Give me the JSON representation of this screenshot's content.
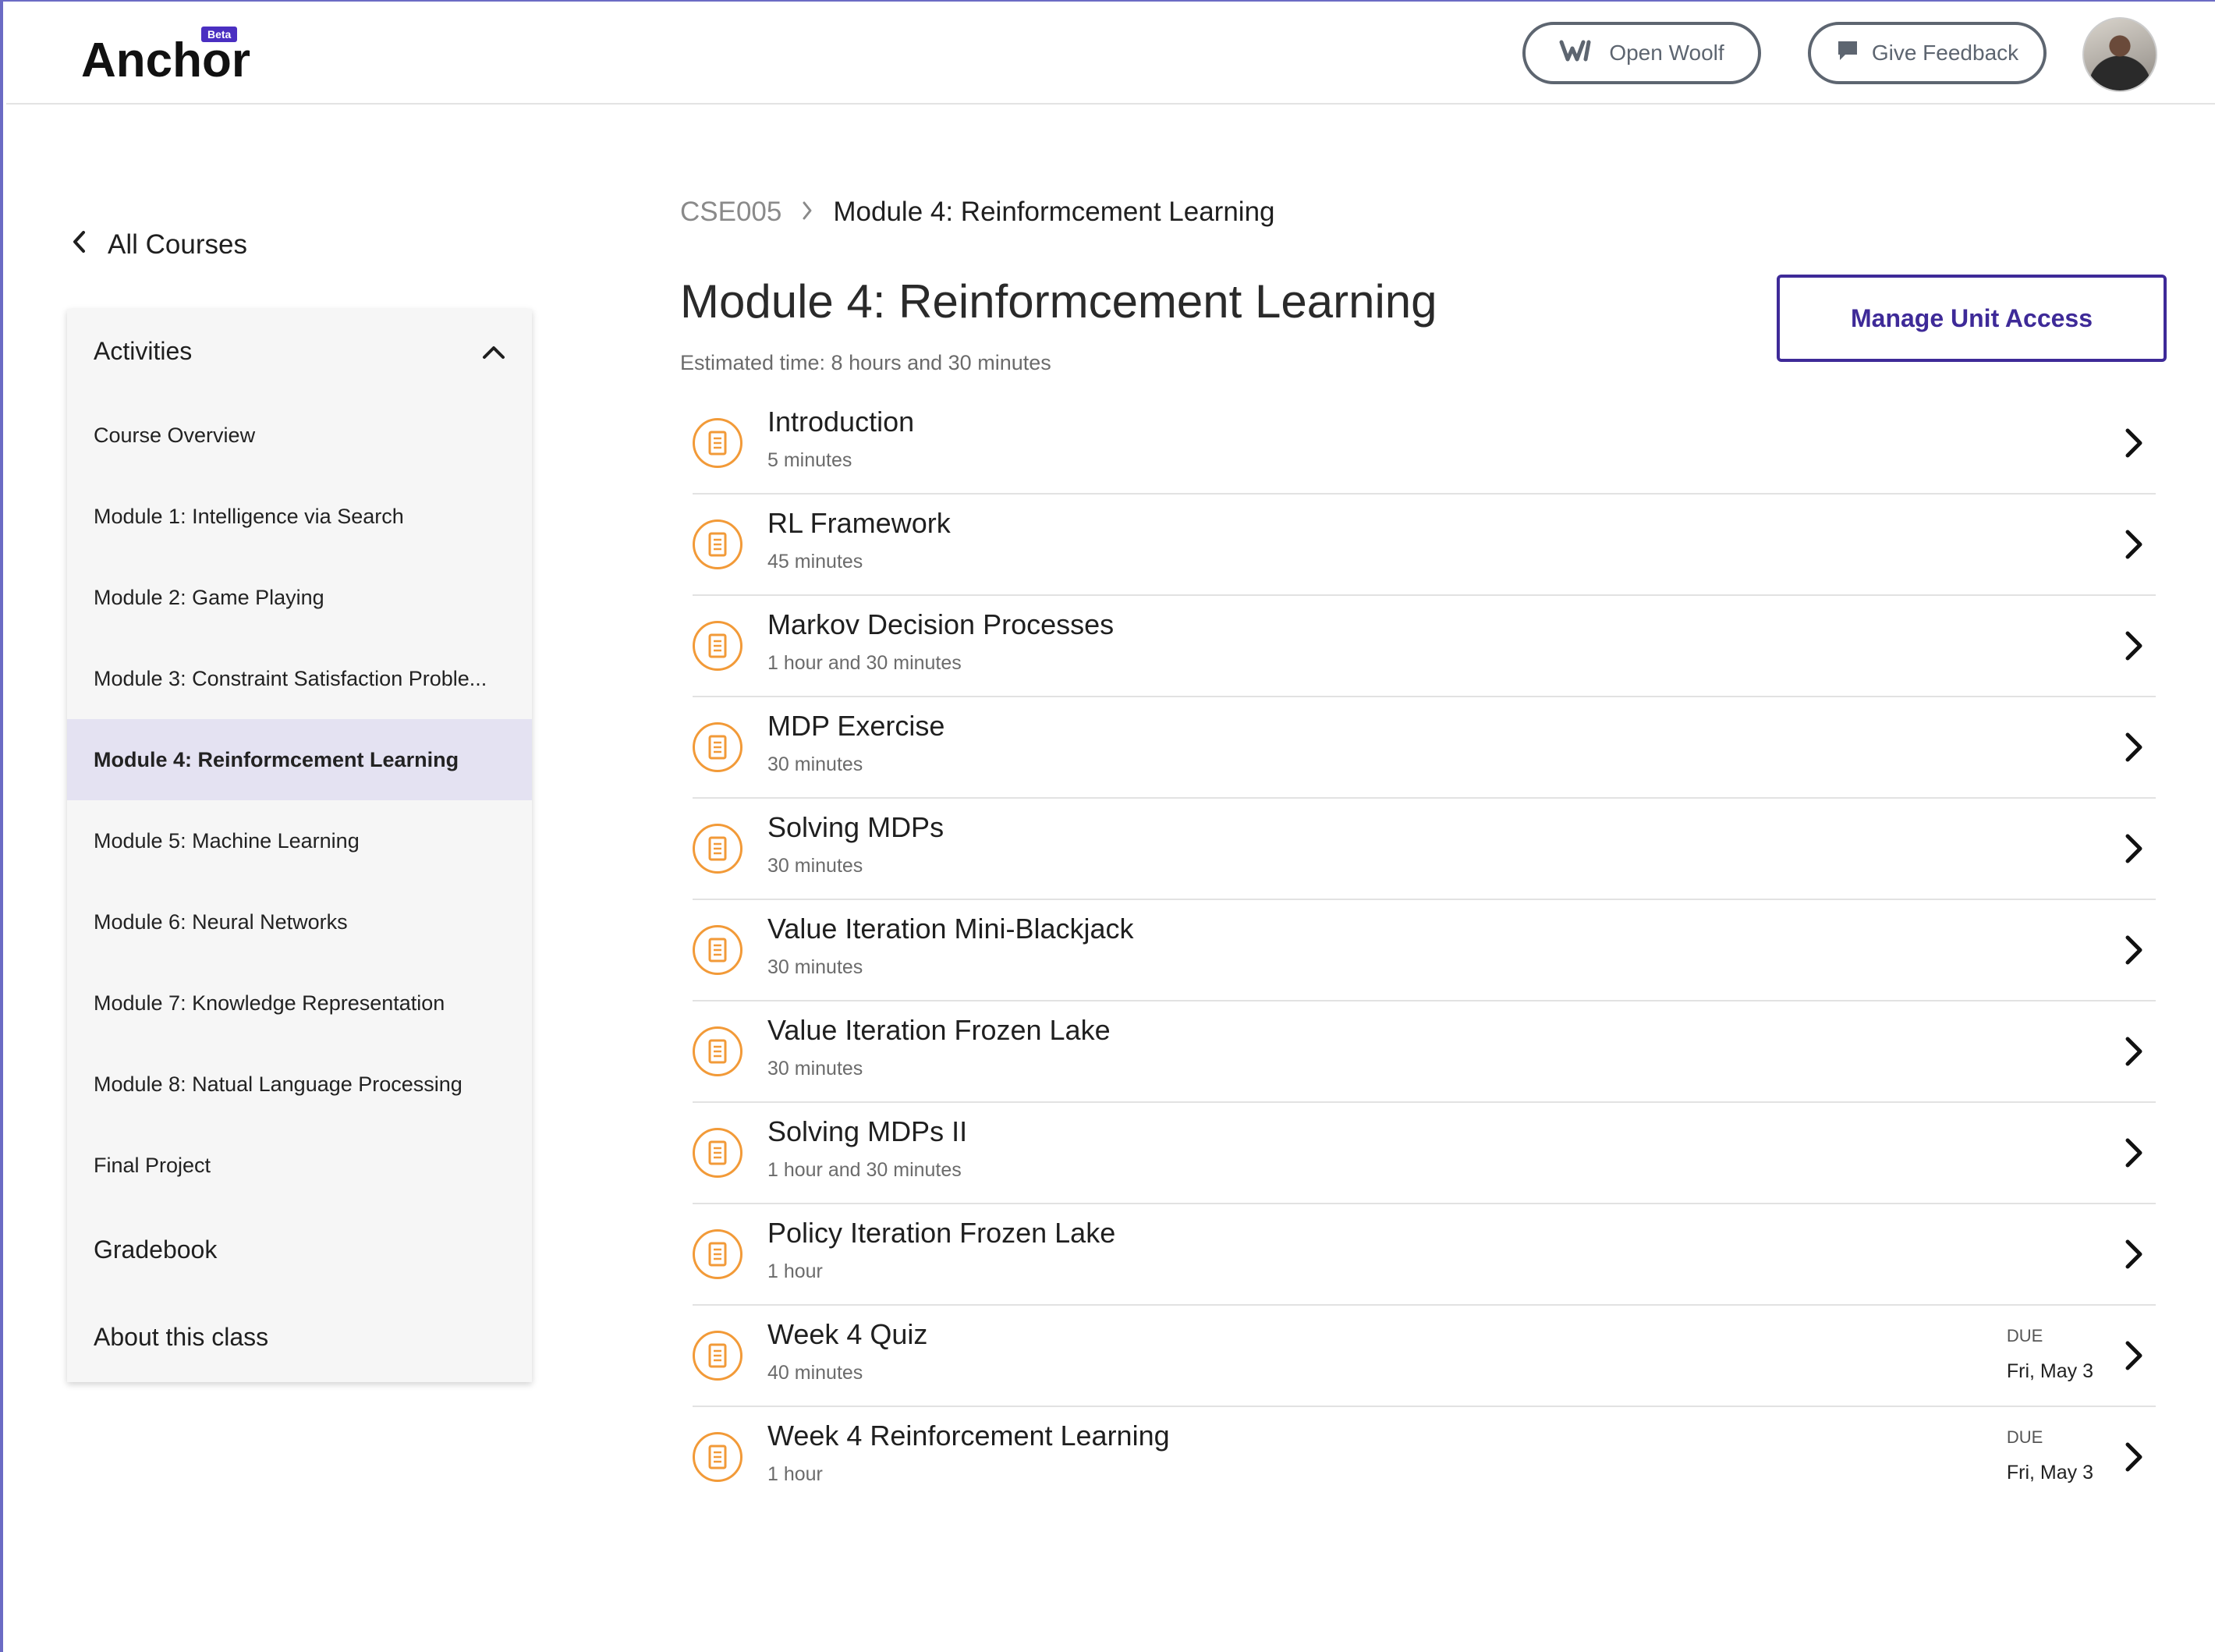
{
  "header": {
    "logo": "Anchor",
    "beta": "Beta",
    "open_woolf": "Open Woolf",
    "give_feedback": "Give Feedback"
  },
  "sidebar": {
    "back_label": "All Courses",
    "section_title": "Activities",
    "items": [
      {
        "label": "Course Overview",
        "active": false
      },
      {
        "label": "Module 1: Intelligence via Search",
        "active": false
      },
      {
        "label": "Module 2: Game Playing",
        "active": false
      },
      {
        "label": "Module 3: Constraint Satisfaction Proble...",
        "active": false
      },
      {
        "label": "Module 4: Reinformcement Learning",
        "active": true
      },
      {
        "label": "Module 5: Machine Learning",
        "active": false
      },
      {
        "label": "Module 6: Neural Networks",
        "active": false
      },
      {
        "label": "Module 7: Knowledge Representation",
        "active": false
      },
      {
        "label": "Module 8: Natual Language Processing",
        "active": false
      },
      {
        "label": "Final Project",
        "active": false
      }
    ],
    "gradebook": "Gradebook",
    "about": "About this class"
  },
  "breadcrumb": {
    "course": "CSE005",
    "current": "Module 4: Reinformcement Learning"
  },
  "main": {
    "title": "Module 4: Reinformcement Learning",
    "estimated": "Estimated time: 8 hours and 30 minutes",
    "manage_button": "Manage Unit Access",
    "activities": [
      {
        "title": "Introduction",
        "duration": "5 minutes"
      },
      {
        "title": "RL Framework",
        "duration": "45 minutes"
      },
      {
        "title": "Markov Decision Processes",
        "duration": "1 hour and 30 minutes"
      },
      {
        "title": "MDP Exercise",
        "duration": "30 minutes"
      },
      {
        "title": "Solving MDPs",
        "duration": "30 minutes"
      },
      {
        "title": "Value Iteration Mini-Blackjack",
        "duration": "30 minutes"
      },
      {
        "title": "Value Iteration Frozen Lake",
        "duration": "30 minutes"
      },
      {
        "title": "Solving MDPs II",
        "duration": "1 hour and 30 minutes"
      },
      {
        "title": "Policy Iteration Frozen Lake",
        "duration": "1 hour"
      },
      {
        "title": "Week 4 Quiz",
        "duration": "40 minutes",
        "due_label": "DUE",
        "due_date": "Fri, May 3"
      },
      {
        "title": "Week 4 Reinforcement Learning",
        "duration": "1 hour",
        "due_label": "DUE",
        "due_date": "Fri, May 3"
      }
    ]
  },
  "colors": {
    "accent": "#3e2a98",
    "icon_orange": "#f29a38",
    "active_bg": "#e4e2f2"
  }
}
